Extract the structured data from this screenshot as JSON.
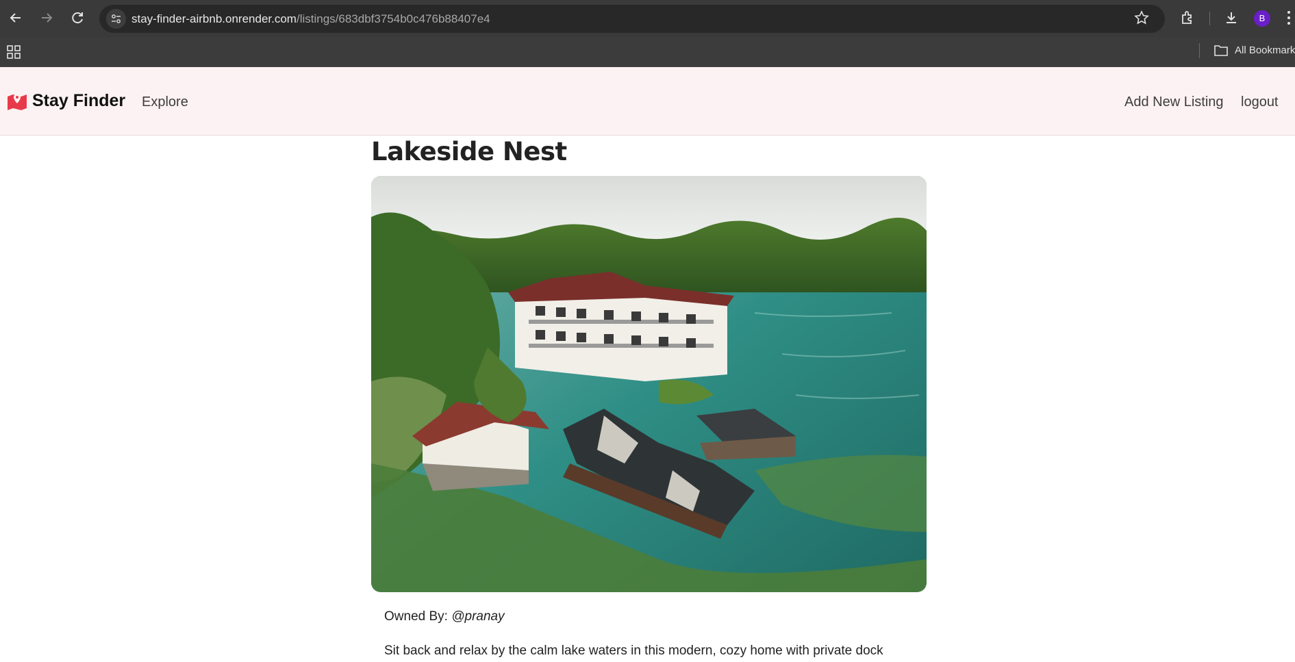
{
  "browser": {
    "url_host": "stay-finder-airbnb.onrender.com",
    "url_path": "/listings/683dbf3754b0c476b88407e4",
    "profile_initial": "B",
    "bookmarks_label": "All Bookmarks",
    "icons": [
      "back-icon",
      "forward-icon",
      "reload-icon",
      "site-info-icon",
      "star-icon",
      "extensions-icon",
      "download-icon",
      "menu-icon",
      "apps-icon",
      "folder-icon"
    ]
  },
  "nav": {
    "brand": "Stay Finder",
    "explore": "Explore",
    "add_listing": "Add New Listing",
    "logout": "logout",
    "brand_color": "#e8394a"
  },
  "listing": {
    "title": "Lakeside Nest",
    "owner_label": "Owned By:",
    "owner": "@pranay",
    "description": "Sit back and relax by the calm lake waters in this modern, cozy home with private dock"
  }
}
